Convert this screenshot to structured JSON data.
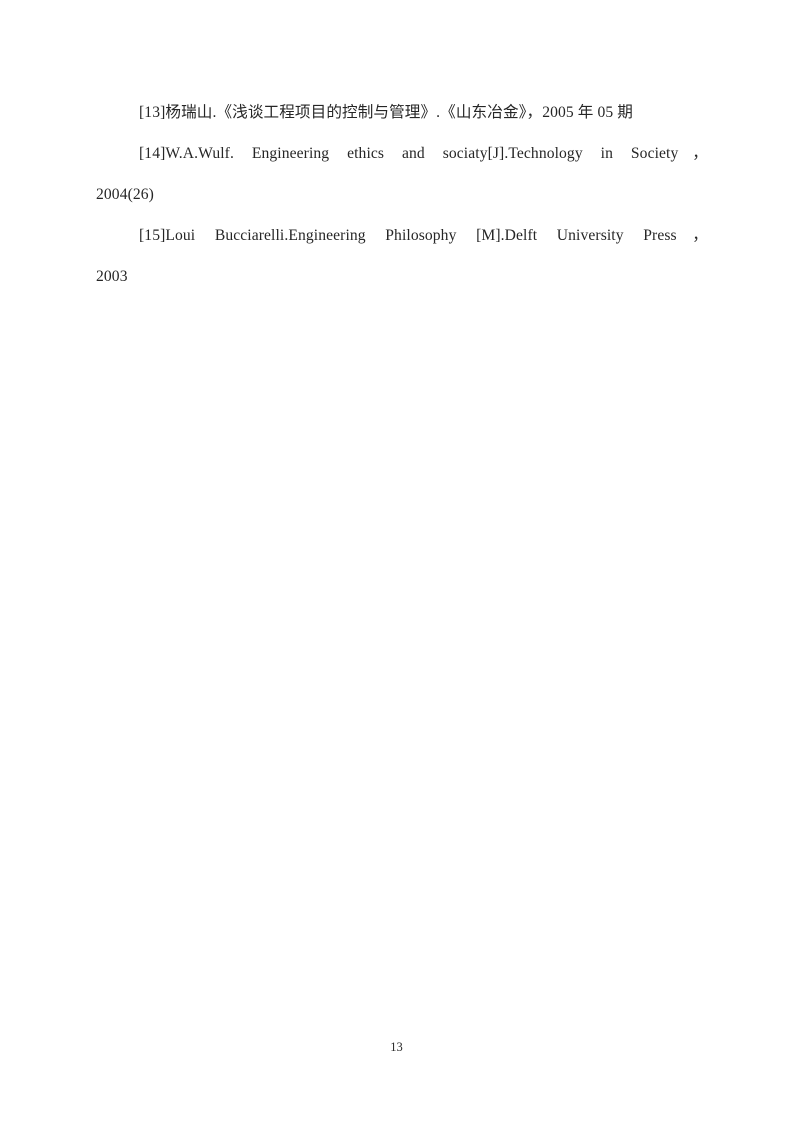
{
  "document": {
    "page_number": "13",
    "text_color": "#262626",
    "background_color": "#ffffff",
    "references": [
      {
        "id": "ref-13",
        "marker": "[13]",
        "line_1": "[13]杨瑞山.《浅谈工程项目的控制与管理》.《山东冶金》，2005 年 05 期",
        "line_2": "",
        "full_text": "[13]杨瑞山.《浅谈工程项目的控制与管理》.《山东冶金》，2005 年 05 期",
        "has_tail": false
      },
      {
        "id": "ref-14",
        "marker": "[14]",
        "line_1": "[14]W.A.Wulf. Engineering ethics and sociaty[J].Technology in Society，",
        "line_2": "2004(26)",
        "full_text": "[14]W.A.Wulf. Engineering ethics and sociaty[J].Technology in Society，2004(26)",
        "has_tail": true
      },
      {
        "id": "ref-15",
        "marker": "[15]",
        "line_1": "[15]Loui   Bucciarelli.Engineering Philosophy [M].Delft University Press，",
        "line_2": "2003",
        "full_text": "[15]Loui   Bucciarelli.Engineering Philosophy [M].Delft University Press，2003",
        "has_tail": true
      }
    ]
  }
}
